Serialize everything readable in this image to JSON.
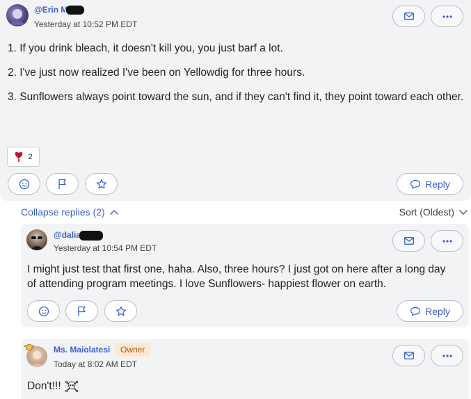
{
  "posts": {
    "main": {
      "author": "@Erin M",
      "timestamp": "Yesterday at 10:52 PM EDT",
      "paragraphs": [
        "1. If you drink bleach, it doesn't kill you, you just barf a lot.",
        "2. I've just now realized I've been on Yellowdig for three hours.",
        "3. Sunflowers always point toward the sun, and if they can't find it, they point toward each other."
      ],
      "reaction_count": "2",
      "reply_label": "Reply"
    },
    "reply1": {
      "author": "@dalia",
      "timestamp": "Yesterday at 10:54 PM EDT",
      "text": "I might just test that first one, haha. Also, three hours? I just got on here after a long day of attending program meetings. I love Sunflowers- happiest flower on earth.",
      "reply_label": "Reply"
    },
    "reply2": {
      "author": "Ms. Maiolatesi",
      "role_badge": "Owner",
      "timestamp": "Today at 8:02 AM EDT",
      "text": "Don't!!!"
    }
  },
  "thread": {
    "collapse_label": "Collapse replies (2)",
    "sort_label": "Sort (Oldest)"
  },
  "colors": {
    "accent": "#3a5fcd",
    "card_bg": "#f2f3f5",
    "heart": "#c8102e",
    "owner_badge_bg": "#fde8cf"
  },
  "icons": [
    "mail-icon",
    "more-dots-icon",
    "smiley-icon",
    "flag-icon",
    "star-icon",
    "speech-bubble-icon",
    "heart-icon",
    "chevron-up-icon",
    "chevron-down-icon",
    "skull-crossbones-icon",
    "graduation-cap-icon"
  ]
}
